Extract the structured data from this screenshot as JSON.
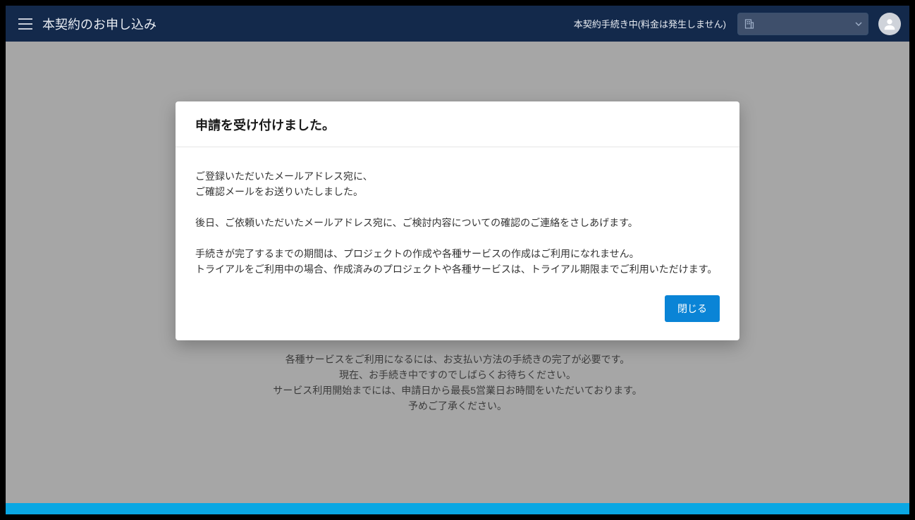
{
  "header": {
    "title": "本契約のお申し込み",
    "status": "本契約手続き中(料金は発生しません)",
    "select_placeholder": ""
  },
  "background": {
    "line1": "各種サービスをご利用になるには、お支払い方法の手続きの完了が必要です。",
    "line2": "現在、お手続き中ですのでしばらくお待ちください。",
    "line3": "サービス利用開始までには、申請日から最長5営業日お時間をいただいております。",
    "line4": "予めご了承ください。"
  },
  "modal": {
    "title": "申請を受け付けました。",
    "para1_line1": "ご登録いただいたメールアドレス宛に、",
    "para1_line2": "ご確認メールをお送りいたしました。",
    "para2": "後日、ご依頼いただいたメールアドレス宛に、ご検討内容についての確認のご連絡をさしあげます。",
    "para3_line1": "手続きが完了するまでの期間は、プロジェクトの作成や各種サービスの作成はご利用になれません。",
    "para3_line2": "トライアルをご利用中の場合、作成済みのプロジェクトや各種サービスは、トライアル期限までご利用いただけます。",
    "close_label": "閉じる"
  }
}
